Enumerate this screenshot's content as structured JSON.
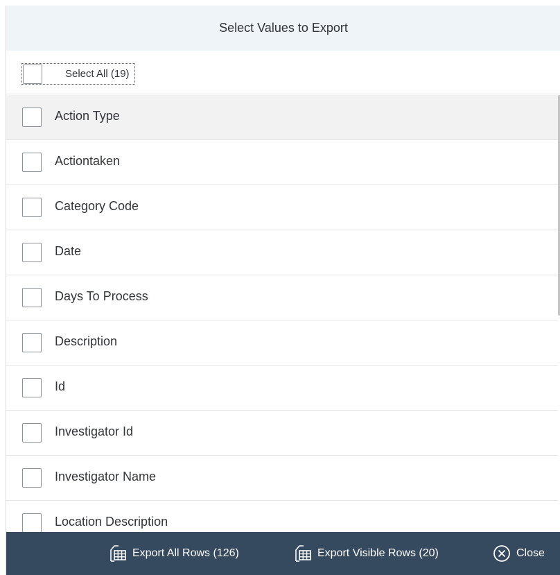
{
  "dialog": {
    "title": "Select Values to Export"
  },
  "select_all": {
    "label": "Select All (19)"
  },
  "items": [
    {
      "label": "Action Type"
    },
    {
      "label": "Actiontaken"
    },
    {
      "label": "Category Code"
    },
    {
      "label": "Date"
    },
    {
      "label": "Days To Process"
    },
    {
      "label": "Description"
    },
    {
      "label": "Id"
    },
    {
      "label": "Investigator Id"
    },
    {
      "label": "Investigator Name"
    },
    {
      "label": "Location Description"
    }
  ],
  "footer": {
    "export_all_label": "Export All Rows (126)",
    "export_visible_label": "Export Visible Rows (20)",
    "close_label": "Close"
  },
  "colors": {
    "header_bg": "#eff4f9",
    "footer_bg": "#354a5f",
    "row_hover_bg": "#f2f2f2"
  },
  "icons": {
    "export": "table-export-icon",
    "close": "circle-x-icon"
  }
}
